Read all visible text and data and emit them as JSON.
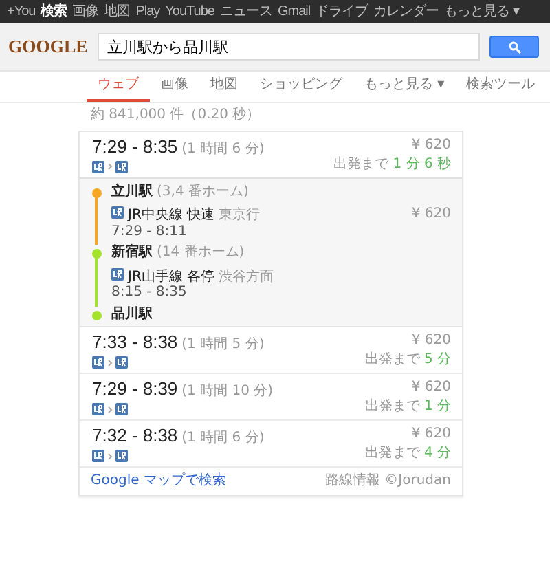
{
  "top_bar": [
    {
      "label": "+You",
      "selected": false
    },
    {
      "label": "検索",
      "selected": true
    },
    {
      "label": "画像",
      "selected": false
    },
    {
      "label": "地図",
      "selected": false
    },
    {
      "label": "Play",
      "selected": false
    },
    {
      "label": "YouTube",
      "selected": false
    },
    {
      "label": "ニュース",
      "selected": false
    },
    {
      "label": "Gmail",
      "selected": false
    },
    {
      "label": "ドライブ",
      "selected": false
    },
    {
      "label": "カレンダー",
      "selected": false
    },
    {
      "label": "もっと見る ▾",
      "selected": false
    }
  ],
  "logo": "GOOGLE",
  "search": {
    "value": "立川駅から品川駅"
  },
  "tabs": [
    {
      "label": "ウェブ",
      "selected": true
    },
    {
      "label": "画像",
      "selected": false
    },
    {
      "label": "地図",
      "selected": false
    },
    {
      "label": "ショッピング",
      "selected": false
    },
    {
      "label": "もっと見る ▾",
      "selected": false
    },
    {
      "label": "検索ツール",
      "selected": false
    }
  ],
  "result_count": "約 841,000 件（0.20 秒）",
  "routes": [
    {
      "times": "7:29 - 8:35",
      "duration": "(1 時間 6 分)",
      "fare": "¥ 620",
      "until_label": "出発まで",
      "until_value": "1 分 6 秒",
      "expanded": true,
      "steps": [
        {
          "kind": "station",
          "name": "立川駅",
          "platform": "(3,4 番ホーム)",
          "color": "#f5a623"
        },
        {
          "kind": "leg",
          "line": "JR中央線 快速",
          "direction": "東京行",
          "times": "7:29 - 8:11",
          "fare": "¥ 620",
          "color": "#f5a623"
        },
        {
          "kind": "station",
          "name": "新宿駅",
          "platform": "(14 番ホーム)",
          "color": "#a4e22b"
        },
        {
          "kind": "leg",
          "line": "JR山手線 各停",
          "direction": "渋谷方面",
          "times": "8:15 - 8:35",
          "color": "#a4e22b"
        },
        {
          "kind": "station",
          "name": "品川駅",
          "color": "#a4e22b"
        }
      ]
    },
    {
      "times": "7:33 - 8:38",
      "duration": "(1 時間 5 分)",
      "fare": "¥ 620",
      "until_label": "出発まで",
      "until_value": "5 分",
      "expanded": false
    },
    {
      "times": "7:29 - 8:39",
      "duration": "(1 時間 10 分)",
      "fare": "¥ 620",
      "until_label": "出発まで",
      "until_value": "1 分",
      "expanded": false
    },
    {
      "times": "7:32 - 8:38",
      "duration": "(1 時間 6 分)",
      "fare": "¥ 620",
      "until_label": "出発まで",
      "until_value": "4 分",
      "expanded": false
    }
  ],
  "footer": {
    "link": "Google マップで検索",
    "credit": "路線情報 ©Jorudan"
  }
}
